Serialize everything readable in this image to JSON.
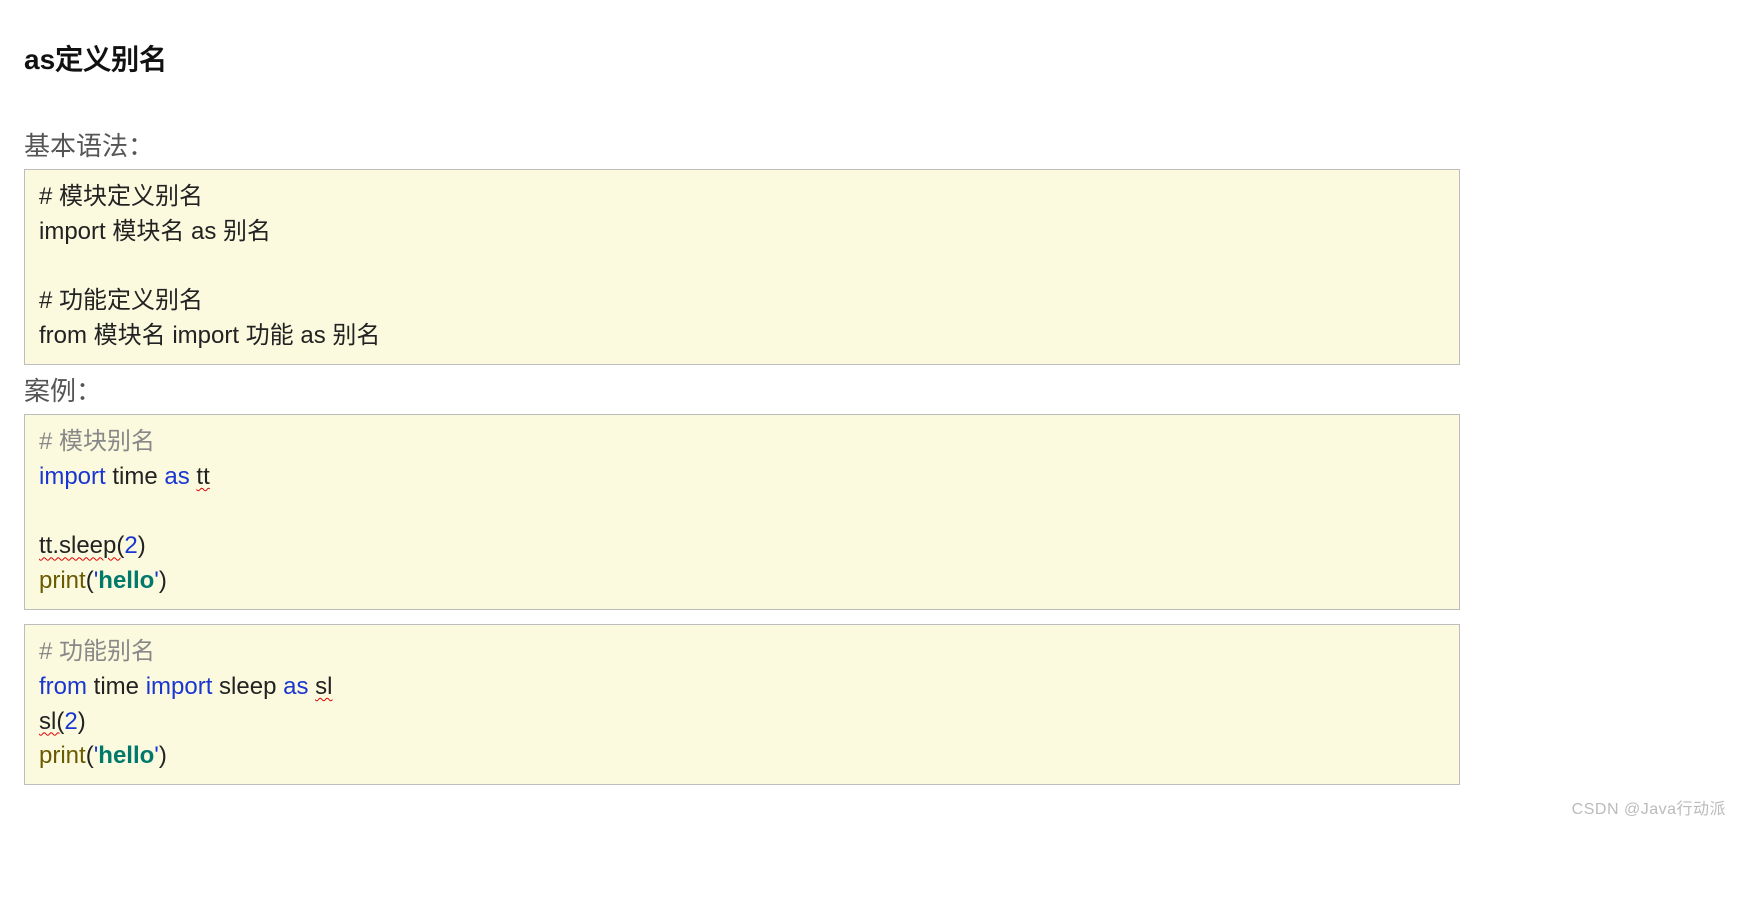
{
  "title": "as定义别名",
  "labels": {
    "syntax": "基本语法：",
    "example": "案例："
  },
  "syntax_box": {
    "c1": "# 模块定义别名",
    "l1": "import 模块名 as 别名",
    "c2": "# 功能定义别名",
    "l2": "from 模块名 import 功能 as 别名"
  },
  "example_box1": {
    "c1": "# 模块别名",
    "l1": {
      "kw_import": "import",
      "mod": " time ",
      "kw_as": "as",
      "sp": " ",
      "alias": "tt"
    },
    "l2": {
      "pre": "tt.sleep(",
      "num": "2",
      "post": ")"
    },
    "l3": {
      "fn": "print",
      "open": "(",
      "q1": "'",
      "str": "hello",
      "q2": "'",
      "close": ")"
    }
  },
  "example_box2": {
    "c1": "# 功能别名",
    "l1": {
      "kw_from": "from",
      "mod": " time ",
      "kw_import": "import",
      "fn": " sleep ",
      "kw_as": "as",
      "sp": " ",
      "alias": "sl"
    },
    "l2": {
      "pre": "sl(",
      "num": "2",
      "post": ")"
    },
    "l3": {
      "fn": "print",
      "open": "(",
      "q1": "'",
      "str": "hello",
      "q2": "'",
      "close": ")"
    }
  },
  "watermark": "CSDN @Java行动派"
}
